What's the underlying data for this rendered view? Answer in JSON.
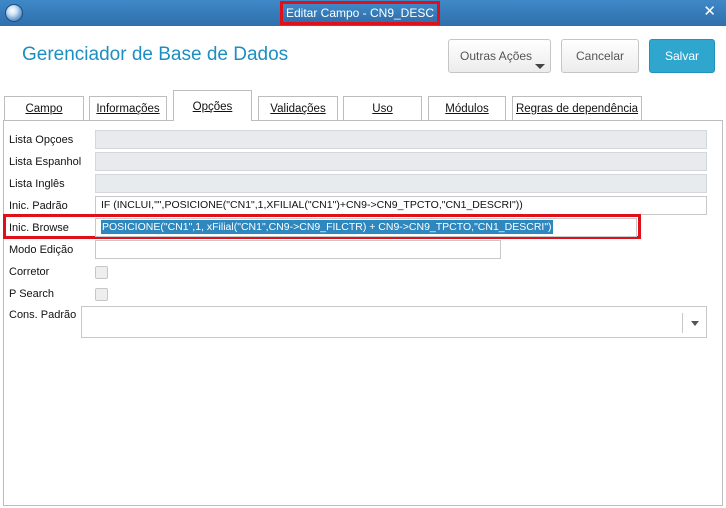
{
  "window": {
    "title": "Editar Campo - CN9_DESC"
  },
  "header": {
    "title": "Gerenciador de Base de Dados",
    "more_actions": "Outras Ações",
    "cancel": "Cancelar",
    "save": "Salvar"
  },
  "tabs": [
    {
      "label": "Campo"
    },
    {
      "label": "Informações"
    },
    {
      "label": "Opções",
      "active": true
    },
    {
      "label": "Validações"
    },
    {
      "label": "Uso"
    },
    {
      "label": "Módulos"
    },
    {
      "label": "Regras de dependência"
    }
  ],
  "form": {
    "lista_opcoes_label": "Lista Opçoes",
    "lista_espanhol_label": "Lista Espanhol",
    "lista_ingles_label": "Lista Inglês",
    "inic_padrao_label": "Inic. Padrão",
    "inic_padrao_value": "IF (INCLUI,\"\",POSICIONE(\"CN1\",1,XFILIAL(\"CN1\")+CN9->CN9_TPCTO,\"CN1_DESCRI\"))",
    "inic_browse_label": "Inic. Browse",
    "inic_browse_value": "POSICIONE(\"CN1\",1, xFilial(\"CN1\",CN9->CN9_FILCTR) + CN9->CN9_TPCTO,\"CN1_DESCRI\")",
    "modo_edicao_label": "Modo Edição",
    "corretor_label": "Corretor",
    "p_search_label": "P Search",
    "cons_padrao_label": "Cons. Padrão"
  },
  "colors": {
    "accent": "#1b8fc3",
    "save_button": "#2ea6ce",
    "highlight": "#e0101a",
    "title_bar": "#3a80c0"
  }
}
